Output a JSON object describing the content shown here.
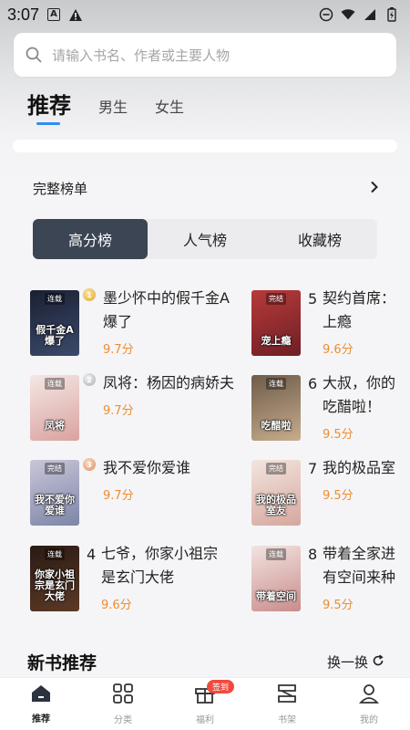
{
  "status_bar": {
    "time": "3:07"
  },
  "search": {
    "placeholder": "请输入书名、作者或主要人物"
  },
  "tabs": [
    {
      "label": "推荐",
      "active": true
    },
    {
      "label": "男生",
      "active": false
    },
    {
      "label": "女生",
      "active": false
    }
  ],
  "ranking": {
    "header": "完整榜单",
    "segments": [
      {
        "label": "高分榜",
        "active": true
      },
      {
        "label": "人气榜",
        "active": false
      },
      {
        "label": "收藏榜",
        "active": false
      }
    ],
    "books": [
      {
        "rank": "1",
        "title": "墨少怀中的假千金A爆了",
        "score": "9.7分",
        "cover_tag": "连载",
        "cover_text": "假千金A爆了",
        "cover_colors": [
          "#1b2033",
          "#3b4a6a"
        ]
      },
      {
        "rank": "2",
        "title": "凤将：杨因的病娇夫",
        "score": "9.7分",
        "cover_tag": "连载",
        "cover_text": "凤将",
        "cover_colors": [
          "#f4e7e4",
          "#d9a2a0"
        ]
      },
      {
        "rank": "3",
        "title": "我不爱你爱谁",
        "score": "9.7分",
        "cover_tag": "完结",
        "cover_text": "我不爱你爱谁",
        "cover_colors": [
          "#c9c6d8",
          "#7c86a8"
        ]
      },
      {
        "rank": "4",
        "title": "七爷，你家小祖宗是玄门大佬",
        "score": "9.6分",
        "cover_tag": "连载",
        "cover_text": "你家小祖宗是玄门大佬",
        "cover_colors": [
          "#2a1a14",
          "#5c3a26"
        ]
      },
      {
        "rank": "5",
        "title": "契约首席：上瘾",
        "score": "9.6分",
        "cover_tag": "完结",
        "cover_text": "宠上瘾",
        "cover_colors": [
          "#b83a3a",
          "#6d1f25"
        ]
      },
      {
        "rank": "6",
        "title": "大叔，你的吃醋啦！",
        "score": "9.5分",
        "cover_tag": "连载",
        "cover_text": "吃醋啦",
        "cover_colors": [
          "#6e5b4a",
          "#c7ad8d"
        ]
      },
      {
        "rank": "7",
        "title": "我的极品室",
        "score": "9.5分",
        "cover_tag": "完结",
        "cover_text": "我的极品室友",
        "cover_colors": [
          "#f3e5df",
          "#d5a79e"
        ]
      },
      {
        "rank": "8",
        "title": "带着全家进有空间来种",
        "score": "9.5分",
        "cover_tag": "连载",
        "cover_text": "带着空间",
        "cover_colors": [
          "#f2e4e0",
          "#c98c8c"
        ]
      }
    ]
  },
  "new_books": {
    "title": "新书推荐",
    "refresh_label": "换一换"
  },
  "bottom_nav": [
    {
      "label": "推荐",
      "icon": "home-icon",
      "active": true
    },
    {
      "label": "分类",
      "icon": "grid-icon",
      "active": false
    },
    {
      "label": "福利",
      "icon": "gift-icon",
      "active": false,
      "badge": "签到"
    },
    {
      "label": "书架",
      "icon": "bookshelf-icon",
      "active": false
    },
    {
      "label": "我的",
      "icon": "user-icon",
      "active": false
    }
  ]
}
